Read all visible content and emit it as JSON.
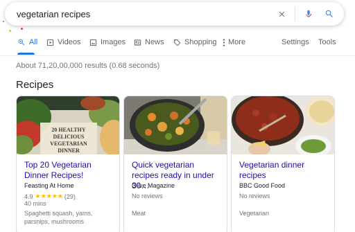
{
  "search": {
    "query": "vegetarian recipes",
    "clear_icon": "close-icon",
    "mic_icon": "microphone-icon",
    "search_icon": "search-icon"
  },
  "tabs": [
    {
      "label": "All",
      "icon": "search-icon",
      "active": true
    },
    {
      "label": "Videos",
      "icon": "video-icon",
      "active": false
    },
    {
      "label": "Images",
      "icon": "image-icon",
      "active": false
    },
    {
      "label": "News",
      "icon": "news-icon",
      "active": false
    },
    {
      "label": "Shopping",
      "icon": "tag-icon",
      "active": false
    },
    {
      "label": "More",
      "icon": "more-vert-icon",
      "active": false
    }
  ],
  "tools": {
    "settings_label": "Settings",
    "tools_label": "Tools"
  },
  "results": {
    "count_text": "About 71,20,00,000 results (0.68 seconds)"
  },
  "recipes": {
    "section_title": "Recipes",
    "cards": [
      {
        "title": "Top 20 Vegetarian Dinner Recipes!",
        "source": "Feasting At Home",
        "rating": "4.9",
        "stars": "★★★★★",
        "review_count": "(29)",
        "time": "40 mins",
        "ingredients": "Spaghetti squash, yams, parsnips, mushrooms",
        "image_overlay_text": "20 HEALTHY DELICIOUS VEGETARIAN DINNER"
      },
      {
        "title": "Quick vegetarian recipes ready in under 30…",
        "source": "Olive Magazine",
        "reviews": "No reviews",
        "category": "Meat"
      },
      {
        "title": "Vegetarian dinner recipes",
        "source": "BBC Good Food",
        "reviews": "No reviews",
        "category": "Vegetarian"
      }
    ]
  },
  "colors": {
    "accent_blue": "#1a73e8",
    "link_blue": "#1a0dab",
    "star_yellow": "#fbbc04",
    "muted_text": "#70757a"
  }
}
